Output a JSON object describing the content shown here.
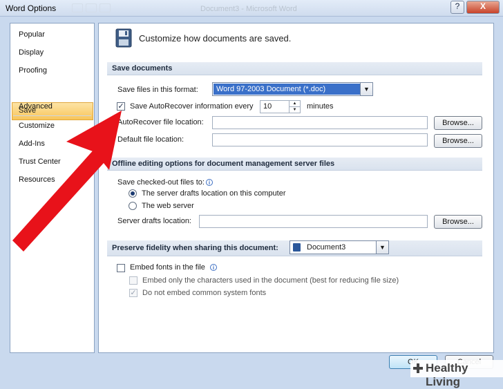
{
  "window": {
    "title": "Word Options",
    "background_title": "Document3 - Microsoft Word",
    "help_label": "?",
    "close_label": "X"
  },
  "nav": {
    "items": [
      "Popular",
      "Display",
      "Proofing",
      "Save",
      "Advanced",
      "Customize",
      "Add-Ins",
      "Trust Center",
      "Resources"
    ],
    "selected": "Save"
  },
  "header": {
    "text": "Customize how documents are saved.",
    "icon": "floppy-disk-icon"
  },
  "save_documents": {
    "section_title": "Save documents",
    "format_label": "Save files in this format:",
    "format_value": "Word 97-2003 Document (*.doc)",
    "autorecover_label": "Save AutoRecover information every",
    "autorecover_checked": true,
    "autorecover_minutes": "10",
    "minutes_label": "minutes",
    "autorecover_location_label": "AutoRecover file location:",
    "autorecover_location_value": "",
    "default_location_label": "Default file location:",
    "default_location_value": "",
    "browse_label": "Browse..."
  },
  "offline": {
    "section_title": "Offline editing options for document management server files",
    "checkout_label": "Save checked-out files to:",
    "option_server_drafts": "The server drafts location on this computer",
    "option_web_server": "The web server",
    "selected_option": "The server drafts location on this computer",
    "server_drafts_label": "Server drafts location:",
    "server_drafts_value": "",
    "browse_label": "Browse..."
  },
  "fidelity": {
    "section_title": "Preserve fidelity when sharing this document:",
    "document_value": "Document3",
    "embed_fonts_label": "Embed fonts in the file",
    "embed_fonts_checked": false,
    "embed_only_label": "Embed only the characters used in the document (best for reducing file size)",
    "embed_only_checked": false,
    "do_not_embed_label": "Do not embed common system fonts",
    "do_not_embed_checked": true
  },
  "buttons": {
    "ok": "OK",
    "cancel": "Cancel"
  },
  "annotation": {
    "arrow_color": "#e8121a"
  },
  "watermark": {
    "text": "Healthy Living"
  },
  "colors": {
    "nav_selected": "#f8c55a",
    "combo_selected": "#3a70c9",
    "section_bg": "#dce4ef"
  }
}
